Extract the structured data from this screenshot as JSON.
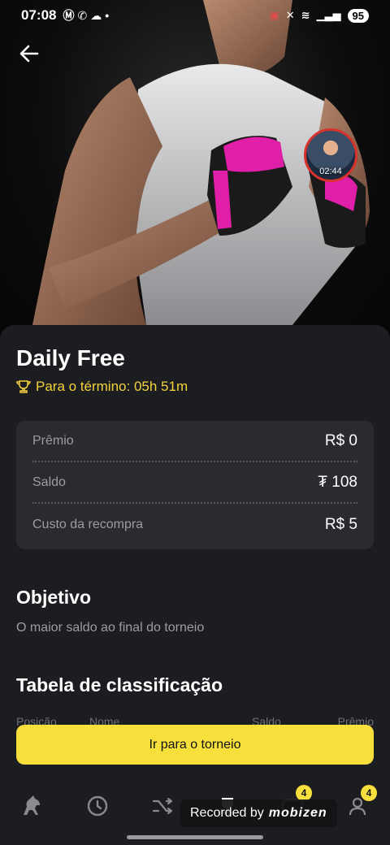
{
  "status_bar": {
    "time": "07:08",
    "battery": "95",
    "notif_icons": [
      "m-icon",
      "whatsapp-icon",
      "cloud-icon",
      "dot"
    ],
    "right_icons": [
      "cast-icon",
      "mute-icon",
      "wifi-icon",
      "signal-icon",
      "signal-icon"
    ]
  },
  "recorder": {
    "timer": "02:44"
  },
  "tournament": {
    "title": "Daily Free",
    "countdown": "Para o término: 05h 51m"
  },
  "info": {
    "rows": [
      {
        "label": "Prêmio",
        "value": "R$ 0"
      },
      {
        "label": "Saldo",
        "value": "₮ 108"
      },
      {
        "label": "Custo da recompra",
        "value": "R$ 5"
      }
    ]
  },
  "objective": {
    "heading": "Objetivo",
    "text": "O maior saldo ao final do torneio"
  },
  "leaderboard": {
    "heading": "Tabela de classificação",
    "columns": [
      "Posição",
      "Nome",
      "Saldo",
      "Prêmio"
    ]
  },
  "cta": {
    "label": "Ir para o torneio"
  },
  "bottom_nav": {
    "items": [
      {
        "icon": "horse-icon"
      },
      {
        "icon": "clock-icon"
      },
      {
        "icon": "shuffle-icon"
      },
      {
        "icon": "trophy-icon"
      },
      {
        "icon": "ticket-icon",
        "badge": "4"
      },
      {
        "icon": "profile-icon",
        "badge": "4"
      }
    ]
  },
  "watermark": {
    "text": "Recorded by",
    "brand": "mobizen"
  },
  "colors": {
    "accent": "#f8e03c",
    "background": "#1c1d21",
    "card": "#2a2b30"
  }
}
